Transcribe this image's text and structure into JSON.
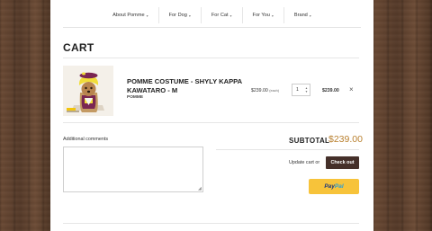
{
  "nav": {
    "items": [
      {
        "label": "About Pomme",
        "caret": "▾"
      },
      {
        "label": "For Dog",
        "caret": "▾"
      },
      {
        "label": "For Cat",
        "caret": "▾"
      },
      {
        "label": "For You",
        "caret": "▾"
      },
      {
        "label": "Brand",
        "caret": "▾"
      }
    ]
  },
  "page": {
    "title": "CART"
  },
  "cart": {
    "items": [
      {
        "name": "POMME COSTUME - SHYLY KAPPA KAWATARO - M",
        "vendor": "POMME",
        "price": "$239.00",
        "price_suffix": "(each)",
        "quantity": "1",
        "line_total": "$239.00",
        "remove_icon": "×"
      }
    ]
  },
  "comments": {
    "label": "Additional comments",
    "value": ""
  },
  "summary": {
    "subtotal_label": "SUBTOTAL",
    "subtotal_value": "$239.00",
    "update_label": "Update cart or",
    "checkout_label": "Check out",
    "paypal_part1": "Pay",
    "paypal_part2": "Pal"
  },
  "colors": {
    "accent_price": "#b9802f",
    "checkout_bg": "#45302a",
    "paypal_bg": "#f7c33a"
  }
}
